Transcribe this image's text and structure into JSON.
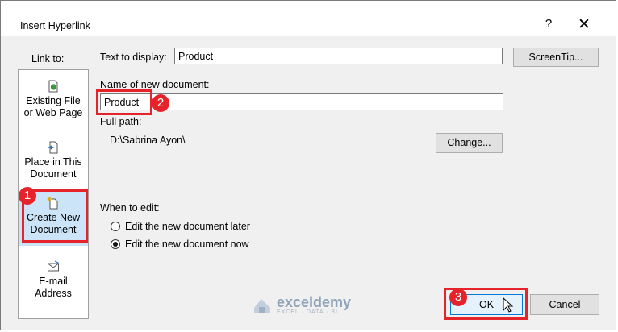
{
  "dialog": {
    "title": "Insert Hyperlink",
    "help_label": "?",
    "close_label": "✕"
  },
  "link_to": {
    "label": "Link to:",
    "items": [
      {
        "label_1": "Existing File",
        "label_2": "or Web Page",
        "icon": "web-page-icon",
        "selected": false
      },
      {
        "label_1": "Place in This",
        "label_2": "Document",
        "icon": "place-in-document-icon",
        "selected": false
      },
      {
        "label_1": "Create New",
        "label_2": "Document",
        "icon": "new-document-icon",
        "selected": true
      },
      {
        "label_1": "E-mail",
        "label_2": "Address",
        "icon": "email-icon",
        "selected": false
      }
    ]
  },
  "form": {
    "text_to_display_label": "Text to display:",
    "text_to_display_value": "Product",
    "screentip_label": "ScreenTip...",
    "name_label": "Name of new document:",
    "name_value": "Product",
    "full_path_label": "Full path:",
    "full_path_value": "D:\\Sabrina Ayon\\",
    "change_label": "Change...",
    "when_to_edit_label": "When to edit:",
    "edit_later_label": "Edit the new document later",
    "edit_now_label": "Edit the new document now",
    "edit_choice": "now"
  },
  "footer": {
    "ok_label": "OK",
    "cancel_label": "Cancel"
  },
  "annotations": {
    "step1": "1",
    "step2": "2",
    "step3": "3",
    "accent_color": "#e5232a"
  },
  "watermark": {
    "name": "exceldemy",
    "tagline": "EXCEL · DATA · BI"
  }
}
